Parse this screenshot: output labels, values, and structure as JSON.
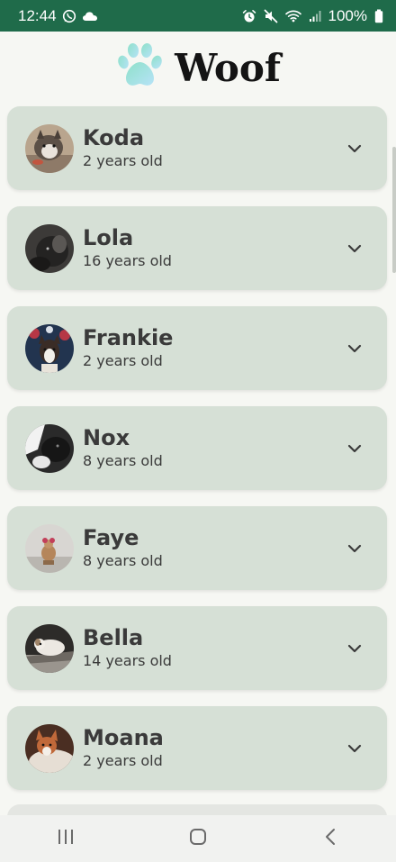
{
  "status_bar": {
    "time": "12:44",
    "battery": "100%",
    "icons": [
      "whatsapp-icon",
      "cloud-icon",
      "alarm-icon",
      "mute-icon",
      "wifi-icon",
      "signal-icon",
      "battery-icon"
    ]
  },
  "header": {
    "title": "Woof",
    "logo_icon": "paw-icon"
  },
  "dogs": [
    {
      "name": "Koda",
      "age": "2 years old"
    },
    {
      "name": "Lola",
      "age": "16 years old"
    },
    {
      "name": "Frankie",
      "age": "2 years old"
    },
    {
      "name": "Nox",
      "age": "8 years old"
    },
    {
      "name": "Faye",
      "age": "8 years old"
    },
    {
      "name": "Bella",
      "age": "14 years old"
    },
    {
      "name": "Moana",
      "age": "2 years old"
    }
  ],
  "nav_bar": {
    "icons": [
      "recent-apps-icon",
      "home-icon",
      "back-icon"
    ]
  },
  "colors": {
    "status_bar": "#1f6b4a",
    "background": "#f6f7f3",
    "card": "#d6e0d6",
    "text": "#3a3a3a",
    "logo_gradient_start": "#8ee0c9",
    "logo_gradient_end": "#b6e3f7"
  }
}
